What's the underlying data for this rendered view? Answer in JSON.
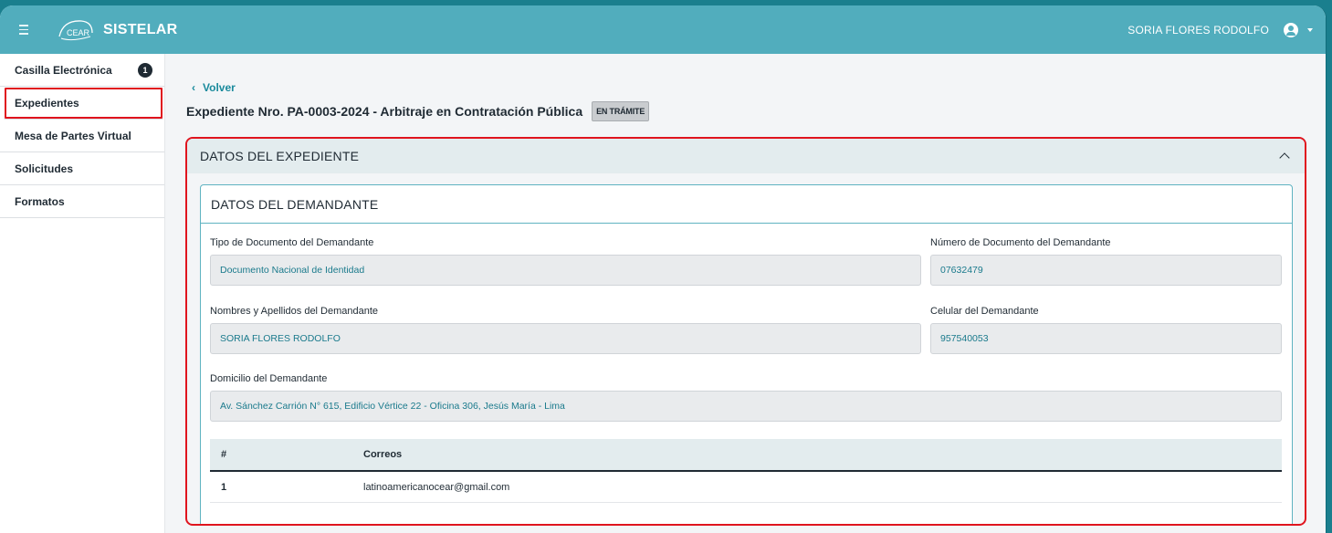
{
  "app": {
    "title": "SISTELAR",
    "logo_text": "CEAR",
    "user_name": "SORIA FLORES RODOLFO"
  },
  "sidebar": {
    "items": [
      {
        "label": "Casilla Electrónica",
        "badge": "1"
      },
      {
        "label": "Expedientes",
        "active": true
      },
      {
        "label": "Mesa de Partes Virtual"
      },
      {
        "label": "Solicitudes"
      },
      {
        "label": "Formatos"
      }
    ]
  },
  "main": {
    "back_label": "Volver",
    "title": "Expediente Nro. PA-0003-2024 - Arbitraje en Contratación Pública",
    "status": "EN TRÁMITE",
    "panel": {
      "title": "DATOS DEL EXPEDIENTE",
      "card": {
        "title": "DATOS DEL DEMANDANTE",
        "fields": {
          "tipo_doc_label": "Tipo de Documento del Demandante",
          "tipo_doc_value": "Documento Nacional de Identidad",
          "num_doc_label": "Número de Documento del Demandante",
          "num_doc_value": "07632479",
          "nombres_label": "Nombres y Apellidos del Demandante",
          "nombres_value": "SORIA FLORES RODOLFO",
          "celular_label": "Celular del Demandante",
          "celular_value": "957540053",
          "domicilio_label": "Domicilio del Demandante",
          "domicilio_value": "Av. Sánchez Carrión N° 615, Edificio Vértice 22 - Oficina 306, Jesús María - Lima"
        },
        "emails_table": {
          "headers": [
            "#",
            "Correos"
          ],
          "rows": [
            [
              "1",
              "latinoamericanocear@gmail.com"
            ]
          ]
        }
      }
    }
  },
  "colors": {
    "topbar": "#51adbd",
    "accent": "#1a8a9c",
    "highlight": "#e0141e"
  }
}
